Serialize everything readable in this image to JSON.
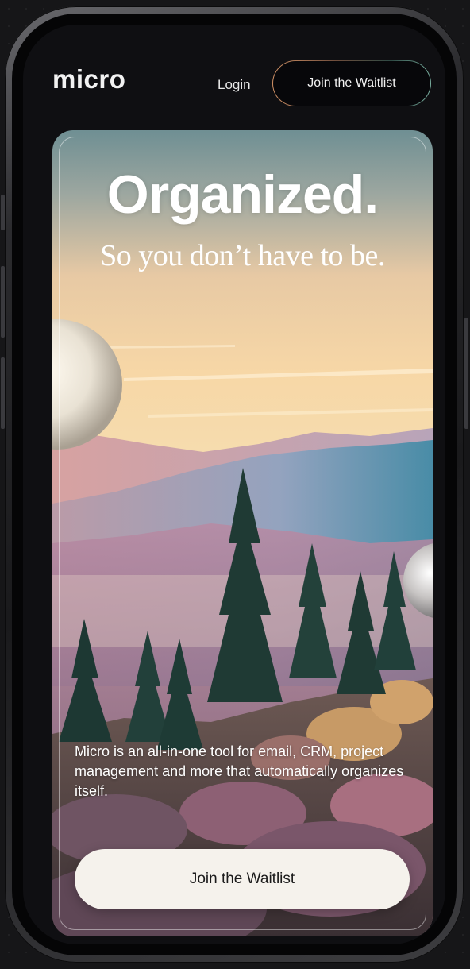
{
  "header": {
    "logo_text": "micro",
    "login_label": "Login",
    "waitlist_label": "Join the Waitlist"
  },
  "hero": {
    "headline": "Organized.",
    "subheadline": "So you don’t have to be.",
    "description": "Micro is an all-in-one tool for email, CRM, project management and more that automatically organizes itself.",
    "cta_label": "Join the Waitlist"
  },
  "colors": {
    "background": "#161618",
    "screen": "#0f0f12",
    "cta_background": "#f5f2ec",
    "cta_text": "#1b1b1b",
    "text_light": "#ffffff"
  }
}
